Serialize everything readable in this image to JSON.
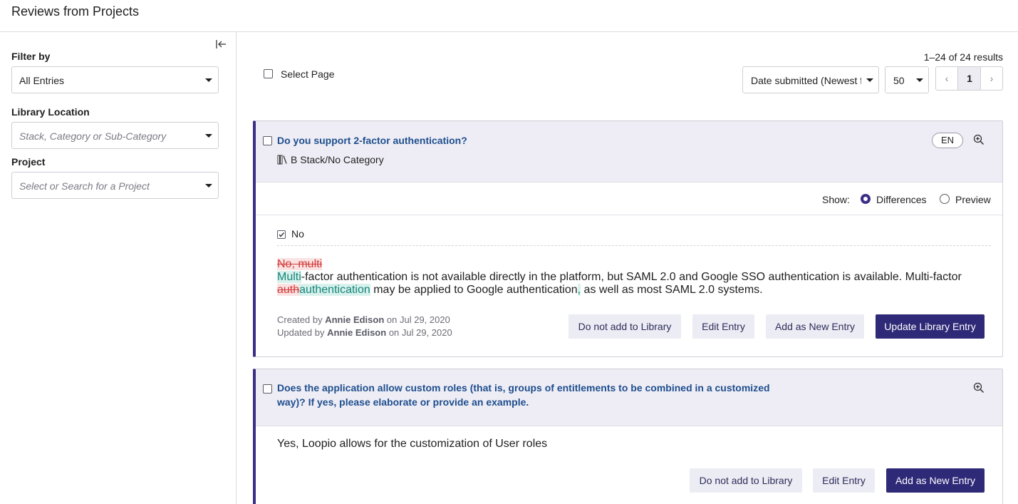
{
  "header": {
    "title": "Reviews from Projects"
  },
  "sidebar": {
    "filter_label": "Filter by",
    "filter_value": "All Entries",
    "library_label": "Library Location",
    "library_placeholder": "Stack, Category or Sub-Category",
    "project_label": "Project",
    "project_placeholder": "Select or Search for a Project"
  },
  "toolbar": {
    "results": "1–24 of 24 results",
    "select_page": "Select Page",
    "sort_value": "Date submitted (Newest first)",
    "per_page": "50",
    "pager_prev": "‹",
    "pager_current": "1",
    "pager_next": "›"
  },
  "entries": [
    {
      "question": "Do you support 2-factor authentication?",
      "language": "EN",
      "location": "B Stack/No Category",
      "show_label": "Show:",
      "show_options": [
        "Differences",
        "Preview"
      ],
      "selected_show": "Differences",
      "answer_option": "No",
      "diff": {
        "deleted_1": "No, multi",
        "inserted_1": "Multi",
        "text_1": "-factor authentication is not available directly in the platform, but SAML 2.0 and Google SSO authentication is available. Multi-factor ",
        "deleted_2": "auth",
        "inserted_2": "authentication",
        "text_2": " may be applied to Google authentication",
        "inserted_3": ",",
        "text_3": " as well as most SAML 2.0 systems."
      },
      "created_prefix": "Created by",
      "created_by": "Annie Edison",
      "created_on": "on Jul 29, 2020",
      "updated_prefix": "Updated by",
      "updated_by": "Annie Edison",
      "updated_on": "on Jul 29, 2020",
      "buttons": {
        "do_not_add": "Do not add to Library",
        "edit": "Edit Entry",
        "add_new": "Add as New Entry",
        "update": "Update Library Entry"
      }
    },
    {
      "question_line_1": "Does the application allow custom roles (that is, groups of entitlements to be combined in a customized",
      "question_line_2": "way)? If yes, please elaborate or provide an example.",
      "answer": "Yes, Loopio allows for the customization of User roles",
      "buttons": {
        "do_not_add": "Do not add to Library",
        "edit": "Edit Entry",
        "add_new": "Add as New Entry"
      }
    }
  ],
  "colors": {
    "accent": "#2f2a78",
    "question_link": "#1e4e8c",
    "deleted": "#d23c3c",
    "inserted": "#16857a"
  }
}
